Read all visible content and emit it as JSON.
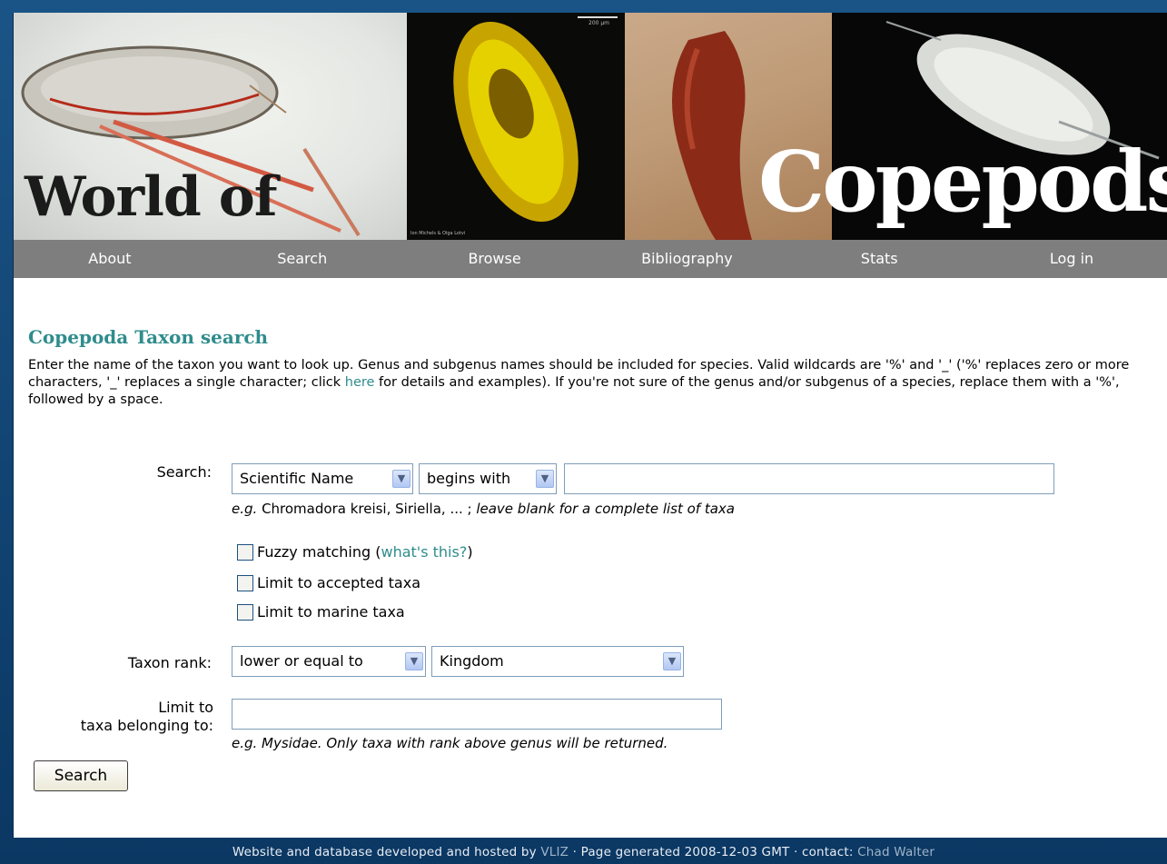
{
  "banner": {
    "title_left": "World of",
    "title_right": "Copepods",
    "scale_label": "200 µm",
    "photo_credit": "Ion Michels & Olga Lotvi"
  },
  "nav": {
    "items": [
      {
        "label": "About"
      },
      {
        "label": "Search"
      },
      {
        "label": "Browse"
      },
      {
        "label": "Bibliography"
      },
      {
        "label": "Stats"
      },
      {
        "label": "Log in"
      }
    ]
  },
  "main": {
    "title": "Copepoda Taxon search",
    "intro_part1": "Enter the name of the taxon you want to look up. Genus and subgenus names should be included for species. Valid wildcards are '%' and '_' ('%' replaces zero or more characters, '_' replaces a single character; click ",
    "intro_link": "here",
    "intro_part2": " for details and examples). If you're not sure of the genus and/or subgenus of a species, replace them with a '%', followed by a space."
  },
  "form": {
    "search_label": "Search:",
    "field_select": "Scientific Name",
    "match_select": "begins with",
    "search_value": "",
    "search_hint_eg": "e.g.",
    "search_hint_examples": " Chromadora kreisi, Siriella, ... ;",
    "search_hint_note": " leave blank for a complete list of taxa",
    "fuzzy_label": "Fuzzy matching (",
    "fuzzy_link": "what's this?",
    "fuzzy_close": ")",
    "accepted_label": "Limit to accepted taxa",
    "marine_label": "Limit to marine taxa",
    "rank_label": "Taxon rank:",
    "rank_op_select": "lower or equal to",
    "rank_select": "Kingdom",
    "limit_label_line1": "Limit to",
    "limit_label_line2": "taxa belonging to:",
    "limit_value": "",
    "limit_hint": "e.g. Mysidae. Only taxa with rank above genus will be returned.",
    "submit_label": "Search"
  },
  "footer": {
    "text1": "Website and database developed and hosted by ",
    "vliz": "VLIZ",
    "text2": " · Page generated 2008-12-03 GMT · contact: ",
    "contact": "Chad Walter"
  }
}
